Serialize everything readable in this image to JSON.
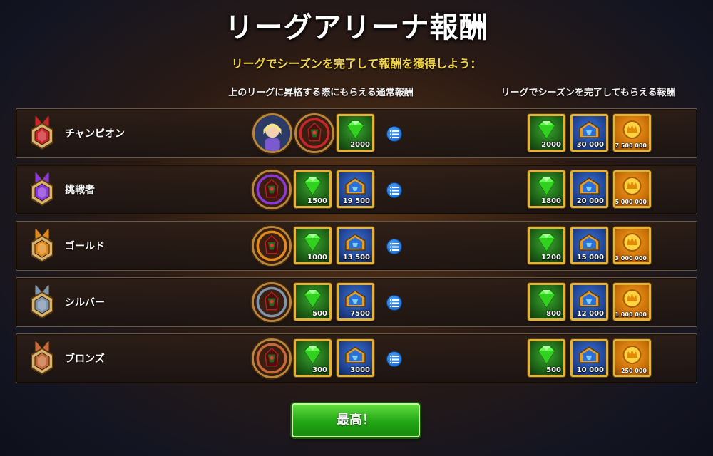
{
  "title": "リーグアリーナ報酬",
  "subtitle": "リーグでシーズンを完了して報酬を獲得しよう：",
  "columns": {
    "promotion": "上のリーグに昇格する際にもらえる通常報酬",
    "season": "リーグでシーズンを完了してもらえる報酬"
  },
  "colors": {
    "champion": "#c8262b",
    "challenger": "#8a3ad6",
    "gold": "#e08a1e",
    "silver": "#7f94ad",
    "bronze": "#c66a3a"
  },
  "tiers": [
    {
      "name": "チャンピオン",
      "medal_icon": "champion-medal-icon",
      "promotion": {
        "avatars": [
          "hero-avatar-icon",
          "champion-frame-icon"
        ],
        "items": [
          {
            "type": "gem",
            "qty": "2000"
          }
        ]
      },
      "season": [
        {
          "type": "gem",
          "qty": "2000"
        },
        {
          "type": "chest",
          "qty": "30 000"
        },
        {
          "type": "gold",
          "qty": "7 500 000"
        }
      ]
    },
    {
      "name": "挑戦者",
      "medal_icon": "challenger-medal-icon",
      "promotion": {
        "avatars": [
          "challenger-frame-icon"
        ],
        "items": [
          {
            "type": "gem",
            "qty": "1500"
          },
          {
            "type": "chest",
            "qty": "19 500"
          }
        ]
      },
      "season": [
        {
          "type": "gem",
          "qty": "1800"
        },
        {
          "type": "chest",
          "qty": "20 000"
        },
        {
          "type": "gold",
          "qty": "5 000 000"
        }
      ]
    },
    {
      "name": "ゴールド",
      "medal_icon": "gold-medal-icon",
      "promotion": {
        "avatars": [
          "gold-frame-icon"
        ],
        "items": [
          {
            "type": "gem",
            "qty": "1000"
          },
          {
            "type": "chest",
            "qty": "13 500"
          }
        ]
      },
      "season": [
        {
          "type": "gem",
          "qty": "1200"
        },
        {
          "type": "chest",
          "qty": "15 000"
        },
        {
          "type": "gold",
          "qty": "3 000 000"
        }
      ]
    },
    {
      "name": "シルバー",
      "medal_icon": "silver-medal-icon",
      "promotion": {
        "avatars": [
          "silver-frame-icon"
        ],
        "items": [
          {
            "type": "gem",
            "qty": "500"
          },
          {
            "type": "chest",
            "qty": "7500"
          }
        ]
      },
      "season": [
        {
          "type": "gem",
          "qty": "800"
        },
        {
          "type": "chest",
          "qty": "12 000"
        },
        {
          "type": "gold",
          "qty": "1 000 000"
        }
      ]
    },
    {
      "name": "ブロンズ",
      "medal_icon": "bronze-medal-icon",
      "promotion": {
        "avatars": [
          "bronze-frame-icon"
        ],
        "items": [
          {
            "type": "gem",
            "qty": "300"
          },
          {
            "type": "chest",
            "qty": "3000"
          }
        ]
      },
      "season": [
        {
          "type": "gem",
          "qty": "500"
        },
        {
          "type": "chest",
          "qty": "10 000"
        },
        {
          "type": "gold",
          "qty": "250 000"
        }
      ]
    }
  ],
  "confirm_button": "最高！"
}
